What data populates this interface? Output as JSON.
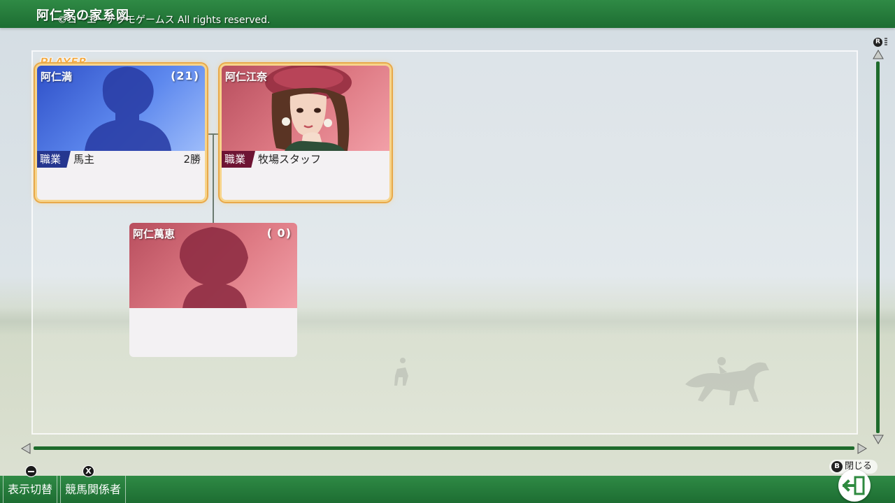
{
  "header": {
    "title": "阿仁家の家系図",
    "copyright": "©コーエーテクモゲームス All rights reserved."
  },
  "player_tag": "PLAYER",
  "family": [
    {
      "name": "阿仁満",
      "age": "(21)",
      "job_label": "職業",
      "job": "馬主",
      "wins": "2勝",
      "theme": "blue",
      "silhouette": "male"
    },
    {
      "name": "阿仁江奈",
      "age": "",
      "job_label": "職業",
      "job": "牧場スタッフ",
      "wins": "",
      "theme": "pink",
      "silhouette": "portrait"
    },
    {
      "name": "阿仁萬恵",
      "age": "( 0)",
      "job_label": "",
      "job": "",
      "wins": "",
      "theme": "pink",
      "silhouette": "female-short"
    }
  ],
  "scroll": {
    "right_stick_label": "R"
  },
  "footer": {
    "buttons": [
      {
        "icon": "minus",
        "label": "表示切替"
      },
      {
        "icon": "X",
        "label": "競馬関係者"
      }
    ],
    "close": {
      "icon": "B",
      "label": "閉じる"
    }
  },
  "colors": {
    "bar_green": "#1d6d32",
    "accent_orange": "#f3a63a",
    "job_blue": "#25368f",
    "job_pink": "#6e1433"
  }
}
